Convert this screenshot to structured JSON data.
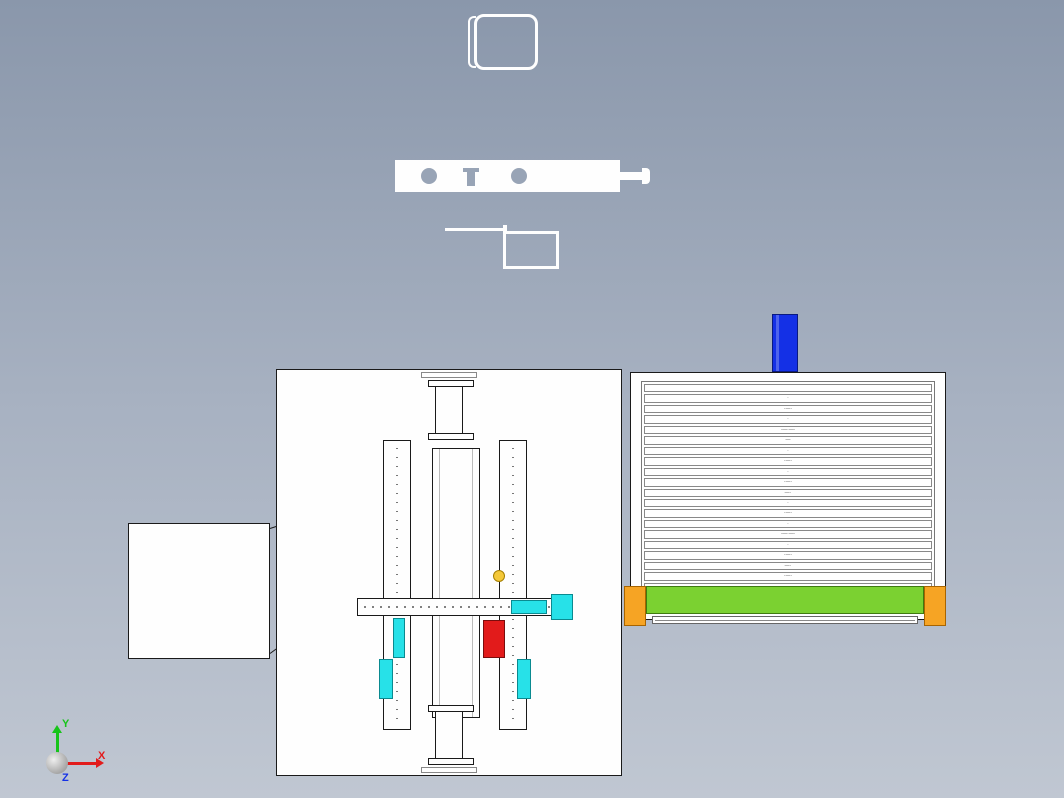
{
  "triad": {
    "x_label": "X",
    "y_label": "Y",
    "z_label": "Z"
  },
  "right_panel": {
    "slot_count": 22,
    "slot_marks": [
      "",
      "·",
      "·—·",
      "·",
      "·—·—·",
      "—",
      "·",
      "·—·",
      "·",
      "·—·",
      "—·",
      "·",
      "·—·",
      "·",
      "·—·—·",
      "·",
      "·—·",
      "—·",
      "·—·",
      "·",
      "·—·",
      ""
    ]
  },
  "colors": {
    "blue": "#1430e6",
    "green": "#7bd131",
    "orange": "#f6a424",
    "red": "#e21b1b",
    "cyan": "#27e1e8",
    "yellow": "#f4c838"
  }
}
